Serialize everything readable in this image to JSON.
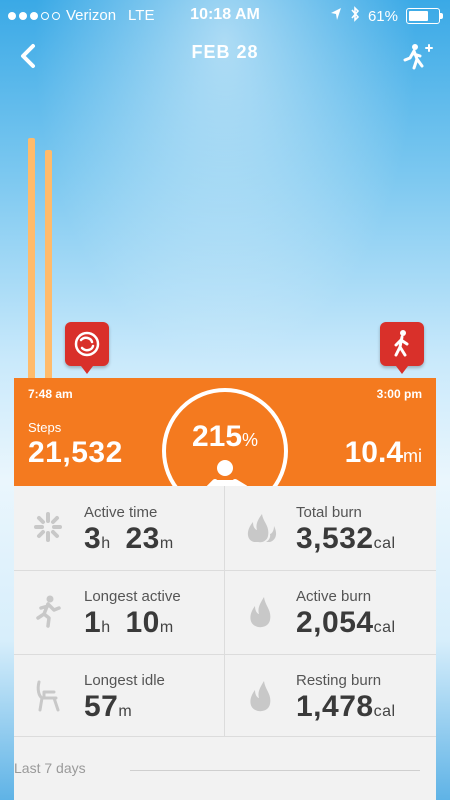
{
  "status": {
    "carrier": "Verizon",
    "network": "LTE",
    "time": "10:18 AM",
    "battery": "61%",
    "signal_bars_filled": 3,
    "signal_bars_total": 5
  },
  "nav": {
    "title": "FEB 28",
    "back_icon": "chevron-left-icon",
    "add_icon": "add-activity-icon"
  },
  "timeline": {
    "start_time": "7:48 am",
    "end_time": "3:00 pm",
    "markers": [
      {
        "icon": "zumba-icon"
      },
      {
        "icon": "walking-icon"
      }
    ]
  },
  "summary": {
    "steps_label": "Steps",
    "steps_value": "21,532",
    "percent_value": "215",
    "percent_symbol": "%",
    "distance_value": "10.4",
    "distance_unit": "mi"
  },
  "stats": [
    {
      "label": "Active time",
      "v1": "3",
      "u1": "h",
      "v2": "23",
      "u2": "m",
      "icon": "active-time-icon"
    },
    {
      "label": "Total burn",
      "v1": "3,532",
      "u1": "cal",
      "v2": "",
      "u2": "",
      "icon": "flames-icon"
    },
    {
      "label": "Longest active",
      "v1": "1",
      "u1": "h",
      "v2": "10",
      "u2": "m",
      "icon": "runner-icon"
    },
    {
      "label": "Active burn",
      "v1": "2,054",
      "u1": "cal",
      "v2": "",
      "u2": "",
      "icon": "flame-icon"
    },
    {
      "label": "Longest idle",
      "v1": "57",
      "u1": "m",
      "v2": "",
      "u2": "",
      "icon": "chair-icon"
    },
    {
      "label": "Resting burn",
      "v1": "1,478",
      "u1": "cal",
      "v2": "",
      "u2": "",
      "icon": "flame-icon"
    }
  ],
  "footer": {
    "last7_label": "Last 7 days"
  },
  "colors": {
    "accent": "#f47a1f",
    "marker": "#d9302a",
    "bar": "#ffbb6b"
  }
}
